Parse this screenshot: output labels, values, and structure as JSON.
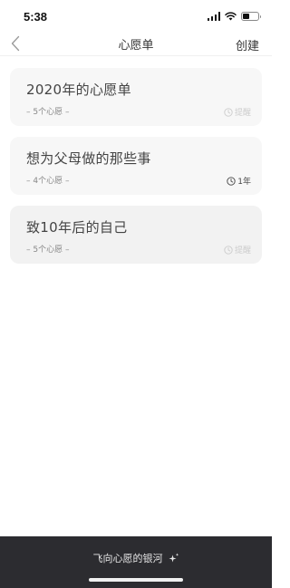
{
  "status_bar": {
    "time": "5:38",
    "battery_level": 0.45
  },
  "nav": {
    "title": "心愿单",
    "action": "创建"
  },
  "wishlists": [
    {
      "title": "2020年的心愿单",
      "count": "– 5个心愿 –",
      "badge": "提醒",
      "badge_icon": "clock-icon",
      "badge_active": false
    },
    {
      "title": "想为父母做的那些事",
      "count": "– 4个心愿 –",
      "badge": "1年",
      "badge_icon": "clock-icon",
      "badge_active": true
    },
    {
      "title": "致10年后的自己",
      "count": "– 5个心愿 –",
      "badge": "提醒",
      "badge_icon": "clock-icon",
      "badge_active": false
    }
  ],
  "bottom": {
    "label": "飞向心愿的银河",
    "icon": "sparkle-icon"
  },
  "colors": {
    "bottom_bar": "#2c2c30",
    "card": "#f7f7f7",
    "card_alt": "#f2f2f2"
  }
}
